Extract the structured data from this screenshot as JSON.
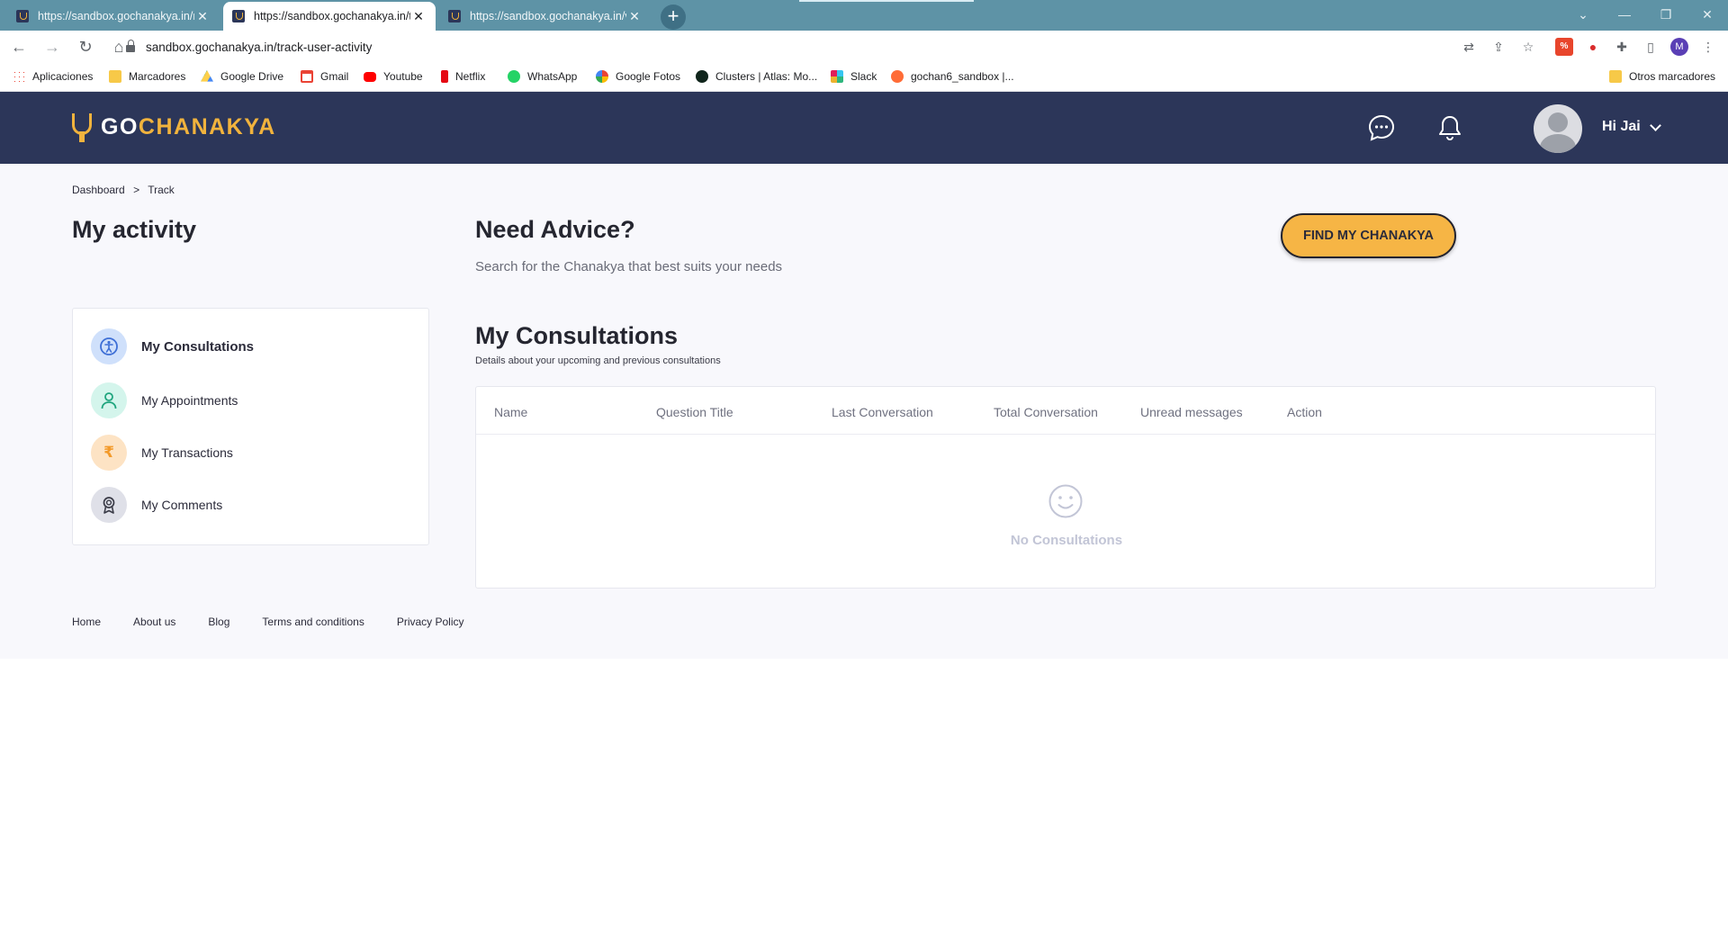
{
  "browser": {
    "tabs": [
      {
        "title": "https://sandbox.gochanakya.in/r",
        "active": false
      },
      {
        "title": "https://sandbox.gochanakya.in/ti",
        "active": true
      },
      {
        "title": "https://sandbox.gochanakya.in/v",
        "active": false
      }
    ],
    "url": "sandbox.gochanakya.in/track-user-activity",
    "profile_initial": "M",
    "bookmarks": [
      {
        "label": "Aplicaciones",
        "icon": "apps-grid-icon",
        "color": "#4285f4"
      },
      {
        "label": "Marcadores",
        "icon": "folder-icon",
        "color": "#f7c948"
      },
      {
        "label": "Google Drive",
        "icon": "google-drive-icon",
        "color": "#1fa463"
      },
      {
        "label": "Gmail",
        "icon": "gmail-icon",
        "color": "#ea4335"
      },
      {
        "label": "Youtube",
        "icon": "youtube-icon",
        "color": "#ff0000"
      },
      {
        "label": "Netflix",
        "icon": "netflix-icon",
        "color": "#e50914"
      },
      {
        "label": "WhatsApp",
        "icon": "whatsapp-icon",
        "color": "#25d366"
      },
      {
        "label": "Google Fotos",
        "icon": "google-photos-icon",
        "color": "#fbbc04"
      },
      {
        "label": "Clusters | Atlas: Mo...",
        "icon": "mongodb-icon",
        "color": "#13aa52"
      },
      {
        "label": "Slack",
        "icon": "slack-icon",
        "color": "#4a154b"
      },
      {
        "label": "gochan6_sandbox |...",
        "icon": "postman-icon",
        "color": "#ff6c37"
      }
    ],
    "other_bookmarks": "Otros marcadores"
  },
  "header": {
    "logo_go": "GO",
    "logo_rest": "CHANAKYA",
    "greeting": "Hi Jai"
  },
  "breadcrumb": [
    "Dashboard",
    ">",
    "Track"
  ],
  "page_title": "My activity",
  "advice": {
    "title": "Need Advice?",
    "subtitle": "Search for the Chanakya that best suits your needs",
    "button": "FIND MY CHANAKYA"
  },
  "sidebar": {
    "items": [
      {
        "label": "My Consultations",
        "icon": "consultation-icon",
        "color": "#cfe0fb",
        "active": true
      },
      {
        "label": "My Appointments",
        "icon": "user-icon",
        "color": "#d4f5ec",
        "active": false
      },
      {
        "label": "My Transactions",
        "icon": "rupee-icon",
        "color": "#fde3c4",
        "active": false
      },
      {
        "label": "My Comments",
        "icon": "badge-icon",
        "color": "#dfe0e8",
        "active": false
      }
    ]
  },
  "consultations": {
    "title": "My Consultations",
    "subtitle": "Details about your upcoming and previous consultations",
    "columns": [
      "Name",
      "Question Title",
      "Last Conversation",
      "Total Conversation",
      "Unread messages",
      "Action"
    ],
    "empty_text": "No Consultations"
  },
  "footer": {
    "links": [
      "Home",
      "About us",
      "Blog",
      "Terms and conditions",
      "Privacy Policy"
    ]
  },
  "colors": {
    "header_bg": "#2c3659",
    "accent": "#f6b545",
    "page_bg": "#f8f8fc"
  }
}
